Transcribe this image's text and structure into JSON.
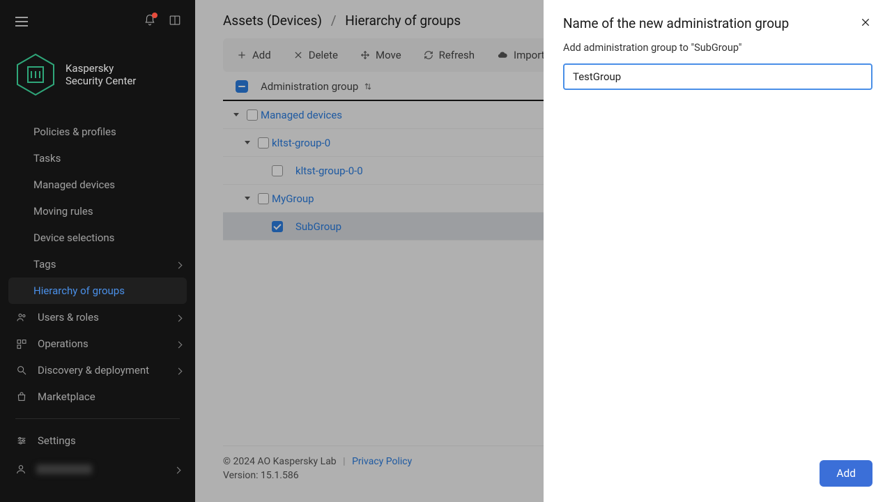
{
  "brand": {
    "line1": "Kaspersky",
    "line2": "Security Center"
  },
  "sidebar": {
    "items": [
      {
        "label": "Policies & profiles"
      },
      {
        "label": "Tasks"
      },
      {
        "label": "Managed devices"
      },
      {
        "label": "Moving rules"
      },
      {
        "label": "Device selections"
      },
      {
        "label": "Tags"
      },
      {
        "label": "Hierarchy of groups"
      },
      {
        "label": "Users & roles"
      },
      {
        "label": "Operations"
      },
      {
        "label": "Discovery & deployment"
      },
      {
        "label": "Marketplace"
      },
      {
        "label": "Settings"
      }
    ]
  },
  "breadcrumb": {
    "root": "Assets (Devices)",
    "leaf": "Hierarchy of groups"
  },
  "toolbar": {
    "add": "Add",
    "delete": "Delete",
    "move": "Move",
    "refresh": "Refresh",
    "import": "Import"
  },
  "tree": {
    "header": "Administration group",
    "rows": [
      {
        "label": "Managed devices"
      },
      {
        "label": "kltst-group-0"
      },
      {
        "label": "kltst-group-0-0"
      },
      {
        "label": "MyGroup"
      },
      {
        "label": "SubGroup"
      }
    ]
  },
  "footer": {
    "copyright": "© 2024 AO Kaspersky Lab",
    "privacy": "Privacy Policy",
    "version": "Version: 15.1.586"
  },
  "panel": {
    "title": "Name of the new administration group",
    "subtitle": "Add administration group to \"SubGroup\"",
    "value": "TestGroup",
    "add": "Add"
  }
}
